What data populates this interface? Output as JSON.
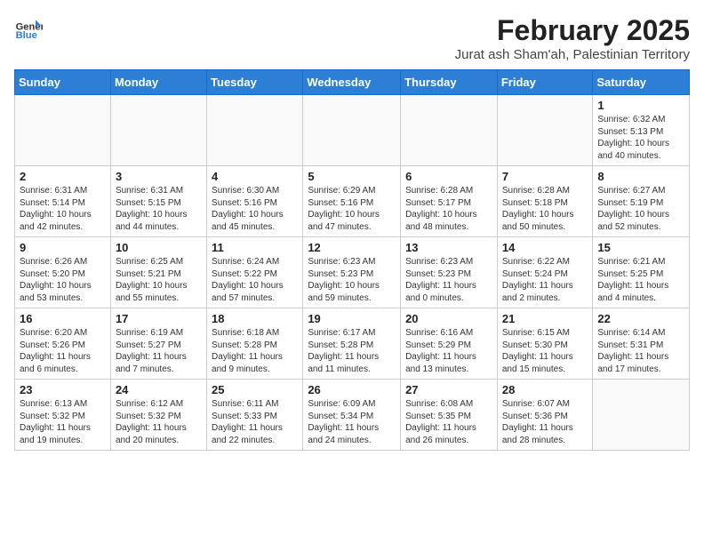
{
  "header": {
    "logo_general": "General",
    "logo_blue": "Blue",
    "title": "February 2025",
    "subtitle": "Jurat ash Sham'ah, Palestinian Territory"
  },
  "weekdays": [
    "Sunday",
    "Monday",
    "Tuesday",
    "Wednesday",
    "Thursday",
    "Friday",
    "Saturday"
  ],
  "weeks": [
    [
      {
        "day": "",
        "info": ""
      },
      {
        "day": "",
        "info": ""
      },
      {
        "day": "",
        "info": ""
      },
      {
        "day": "",
        "info": ""
      },
      {
        "day": "",
        "info": ""
      },
      {
        "day": "",
        "info": ""
      },
      {
        "day": "1",
        "info": "Sunrise: 6:32 AM\nSunset: 5:13 PM\nDaylight: 10 hours\nand 40 minutes."
      }
    ],
    [
      {
        "day": "2",
        "info": "Sunrise: 6:31 AM\nSunset: 5:14 PM\nDaylight: 10 hours\nand 42 minutes."
      },
      {
        "day": "3",
        "info": "Sunrise: 6:31 AM\nSunset: 5:15 PM\nDaylight: 10 hours\nand 44 minutes."
      },
      {
        "day": "4",
        "info": "Sunrise: 6:30 AM\nSunset: 5:16 PM\nDaylight: 10 hours\nand 45 minutes."
      },
      {
        "day": "5",
        "info": "Sunrise: 6:29 AM\nSunset: 5:16 PM\nDaylight: 10 hours\nand 47 minutes."
      },
      {
        "day": "6",
        "info": "Sunrise: 6:28 AM\nSunset: 5:17 PM\nDaylight: 10 hours\nand 48 minutes."
      },
      {
        "day": "7",
        "info": "Sunrise: 6:28 AM\nSunset: 5:18 PM\nDaylight: 10 hours\nand 50 minutes."
      },
      {
        "day": "8",
        "info": "Sunrise: 6:27 AM\nSunset: 5:19 PM\nDaylight: 10 hours\nand 52 minutes."
      }
    ],
    [
      {
        "day": "9",
        "info": "Sunrise: 6:26 AM\nSunset: 5:20 PM\nDaylight: 10 hours\nand 53 minutes."
      },
      {
        "day": "10",
        "info": "Sunrise: 6:25 AM\nSunset: 5:21 PM\nDaylight: 10 hours\nand 55 minutes."
      },
      {
        "day": "11",
        "info": "Sunrise: 6:24 AM\nSunset: 5:22 PM\nDaylight: 10 hours\nand 57 minutes."
      },
      {
        "day": "12",
        "info": "Sunrise: 6:23 AM\nSunset: 5:23 PM\nDaylight: 10 hours\nand 59 minutes."
      },
      {
        "day": "13",
        "info": "Sunrise: 6:23 AM\nSunset: 5:23 PM\nDaylight: 11 hours\nand 0 minutes."
      },
      {
        "day": "14",
        "info": "Sunrise: 6:22 AM\nSunset: 5:24 PM\nDaylight: 11 hours\nand 2 minutes."
      },
      {
        "day": "15",
        "info": "Sunrise: 6:21 AM\nSunset: 5:25 PM\nDaylight: 11 hours\nand 4 minutes."
      }
    ],
    [
      {
        "day": "16",
        "info": "Sunrise: 6:20 AM\nSunset: 5:26 PM\nDaylight: 11 hours\nand 6 minutes."
      },
      {
        "day": "17",
        "info": "Sunrise: 6:19 AM\nSunset: 5:27 PM\nDaylight: 11 hours\nand 7 minutes."
      },
      {
        "day": "18",
        "info": "Sunrise: 6:18 AM\nSunset: 5:28 PM\nDaylight: 11 hours\nand 9 minutes."
      },
      {
        "day": "19",
        "info": "Sunrise: 6:17 AM\nSunset: 5:28 PM\nDaylight: 11 hours\nand 11 minutes."
      },
      {
        "day": "20",
        "info": "Sunrise: 6:16 AM\nSunset: 5:29 PM\nDaylight: 11 hours\nand 13 minutes."
      },
      {
        "day": "21",
        "info": "Sunrise: 6:15 AM\nSunset: 5:30 PM\nDaylight: 11 hours\nand 15 minutes."
      },
      {
        "day": "22",
        "info": "Sunrise: 6:14 AM\nSunset: 5:31 PM\nDaylight: 11 hours\nand 17 minutes."
      }
    ],
    [
      {
        "day": "23",
        "info": "Sunrise: 6:13 AM\nSunset: 5:32 PM\nDaylight: 11 hours\nand 19 minutes."
      },
      {
        "day": "24",
        "info": "Sunrise: 6:12 AM\nSunset: 5:32 PM\nDaylight: 11 hours\nand 20 minutes."
      },
      {
        "day": "25",
        "info": "Sunrise: 6:11 AM\nSunset: 5:33 PM\nDaylight: 11 hours\nand 22 minutes."
      },
      {
        "day": "26",
        "info": "Sunrise: 6:09 AM\nSunset: 5:34 PM\nDaylight: 11 hours\nand 24 minutes."
      },
      {
        "day": "27",
        "info": "Sunrise: 6:08 AM\nSunset: 5:35 PM\nDaylight: 11 hours\nand 26 minutes."
      },
      {
        "day": "28",
        "info": "Sunrise: 6:07 AM\nSunset: 5:36 PM\nDaylight: 11 hours\nand 28 minutes."
      },
      {
        "day": "",
        "info": ""
      }
    ]
  ]
}
